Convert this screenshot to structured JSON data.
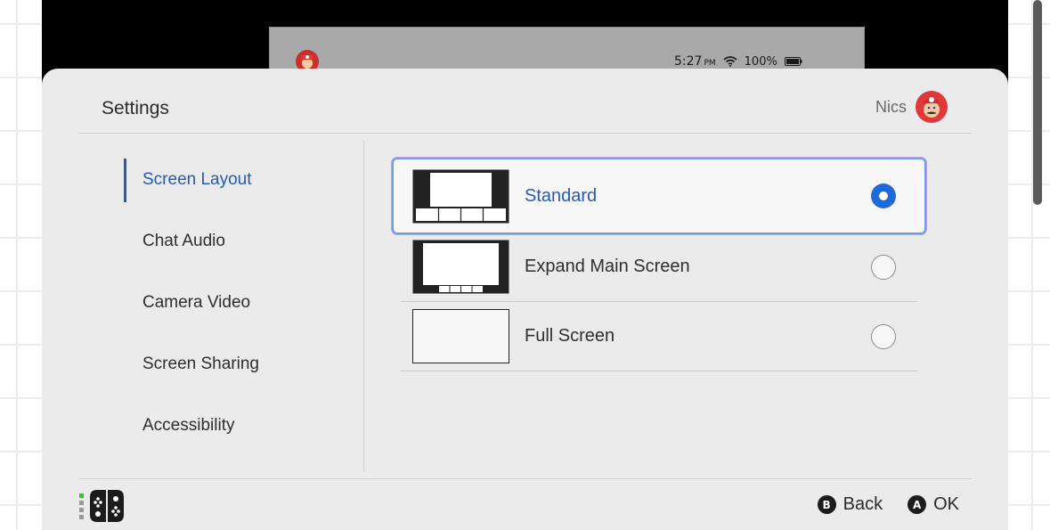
{
  "background": {
    "status_bar": {
      "time": "5:27",
      "ampm": "PM",
      "wifi_icon": "wifi-icon",
      "battery": "100%",
      "battery_icon": "battery-icon"
    }
  },
  "header": {
    "title": "Settings",
    "user_name": "Nics",
    "avatar_icon": "mario-avatar-icon"
  },
  "sidebar": {
    "items": [
      {
        "label": "Screen Layout",
        "active": true
      },
      {
        "label": "Chat Audio",
        "active": false
      },
      {
        "label": "Camera Video",
        "active": false
      },
      {
        "label": "Screen Sharing",
        "active": false
      },
      {
        "label": "Accessibility",
        "active": false
      }
    ]
  },
  "options": [
    {
      "label": "Standard",
      "selected": true,
      "thumb_icon": "standard-layout-icon"
    },
    {
      "label": "Expand Main Screen",
      "selected": false,
      "thumb_icon": "expand-layout-icon"
    },
    {
      "label": "Full Screen",
      "selected": false,
      "thumb_icon": "fullscreen-layout-icon"
    }
  ],
  "footer": {
    "controller_icon": "joycon-controller-icon",
    "back": {
      "glyph": "B",
      "label": "Back"
    },
    "ok": {
      "glyph": "A",
      "label": "OK"
    }
  },
  "colors": {
    "accent": "#2559b4",
    "radio_selected": "#1f6ad6",
    "panel": "#ebebeb",
    "battery_green": "#3fbf3f"
  }
}
